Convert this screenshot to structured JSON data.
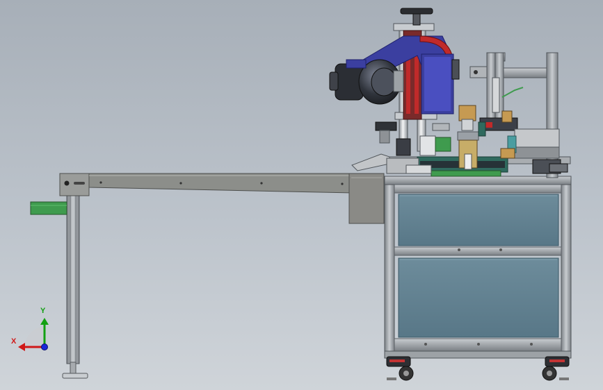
{
  "viewport": {
    "background_top": "#a7afb8",
    "background_bottom": "#cfd4d9"
  },
  "model": {
    "frame_color": "#9ea3a8",
    "glass_color": "#5f7f8f",
    "motor_color": "#3b3f48",
    "blue_part_color": "#3b3fa0",
    "red_part_color": "#c02a2a",
    "green_part_color": "#3f9b4e",
    "conveyor_color": "#8a8a86"
  },
  "triad": {
    "x_label": "X",
    "y_label": "Y",
    "x_color": "#d01818",
    "y_color": "#12a012",
    "z_color": "#1a28d8"
  }
}
